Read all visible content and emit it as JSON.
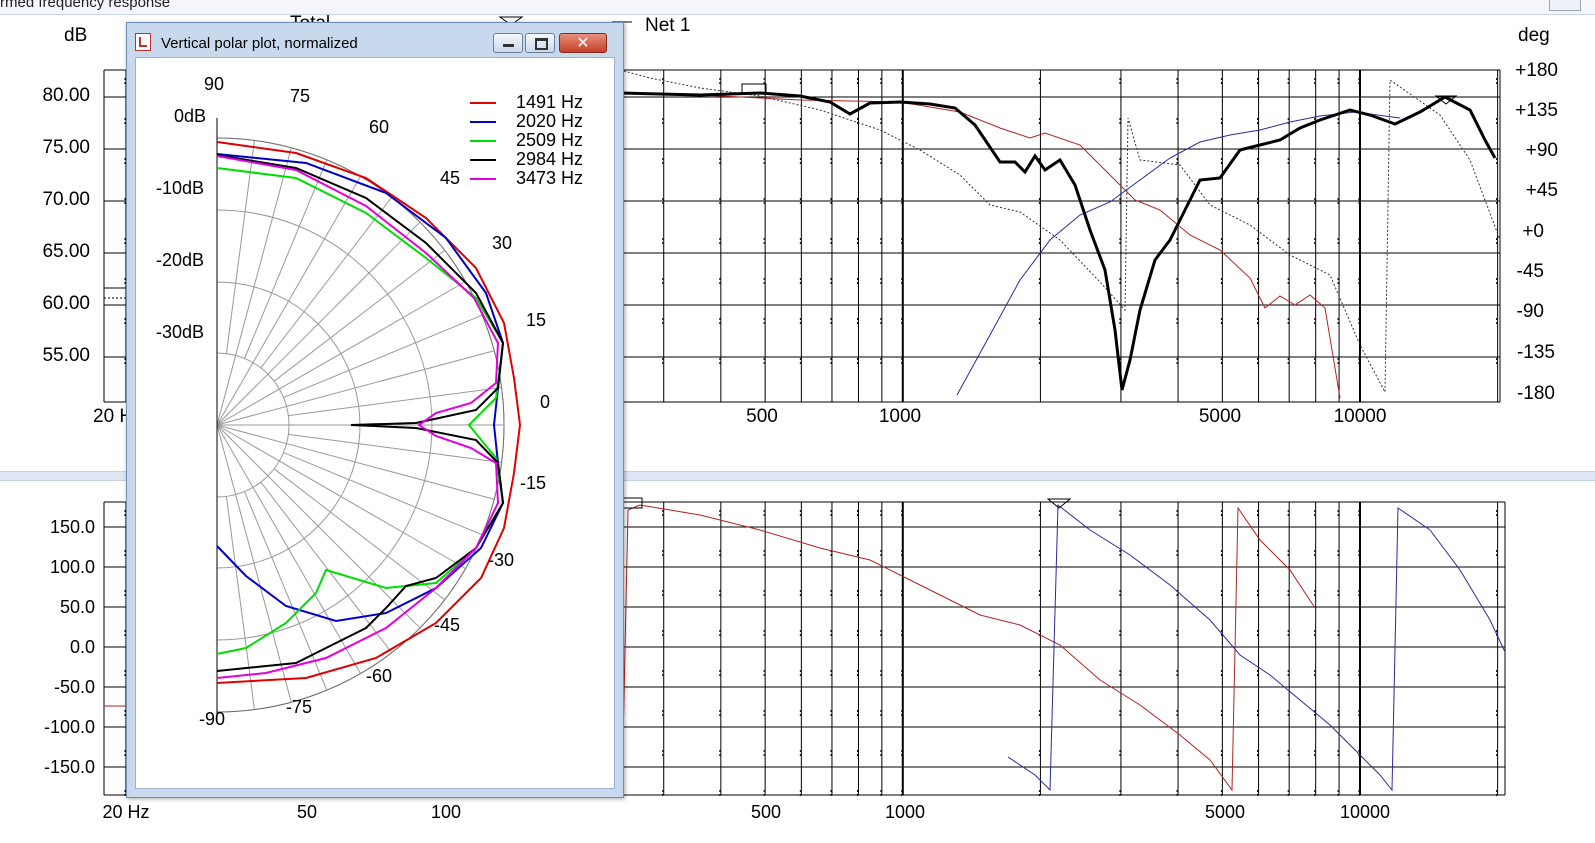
{
  "window_title_partial": "rmed frequency response",
  "top_plot": {
    "legend_text": "Net 1",
    "legend_partial": "Total",
    "left_unit": "dB",
    "right_unit": "deg",
    "y_ticks": [
      "80.00",
      "75.00",
      "70.00",
      "65.00",
      "60.00",
      "55.00"
    ],
    "phase_ticks": [
      "+180",
      "+135",
      "+90",
      "+45",
      "+0",
      "-45",
      "-90",
      "-135",
      "-180"
    ],
    "x_ticks": [
      "500",
      "1000",
      "5000",
      "10000"
    ],
    "x_partial": "20 H",
    "series_colors": {
      "magnitude": "#000000",
      "red": "#b22222",
      "blue": "#2a2a9a",
      "dotted": "#333333"
    }
  },
  "bottom_plot": {
    "y_ticks": [
      "150.0",
      "100.0",
      "50.0",
      "0.0",
      "-50.0",
      "-100.0",
      "-150.0"
    ],
    "x_ticks": [
      "20 Hz",
      "50",
      "100",
      "500",
      "1000",
      "5000",
      "10000"
    ]
  },
  "polar_window": {
    "title": "Vertical polar plot, normalized",
    "close_label": "✕",
    "db_labels": [
      "0dB",
      "-10dB",
      "-20dB",
      "-30dB"
    ],
    "angle_labels": [
      "90",
      "75",
      "60",
      "45",
      "30",
      "15",
      "0",
      "-15",
      "-30",
      "-45",
      "-60",
      "-75",
      "-90"
    ],
    "legend": [
      {
        "label": "1491 Hz",
        "color": "#e00000"
      },
      {
        "label": "2020 Hz",
        "color": "#0000c8"
      },
      {
        "label": "2509 Hz",
        "color": "#00dd00"
      },
      {
        "label": "2984 Hz",
        "color": "#000000"
      },
      {
        "label": "3473 Hz",
        "color": "#e000e0"
      }
    ]
  }
}
